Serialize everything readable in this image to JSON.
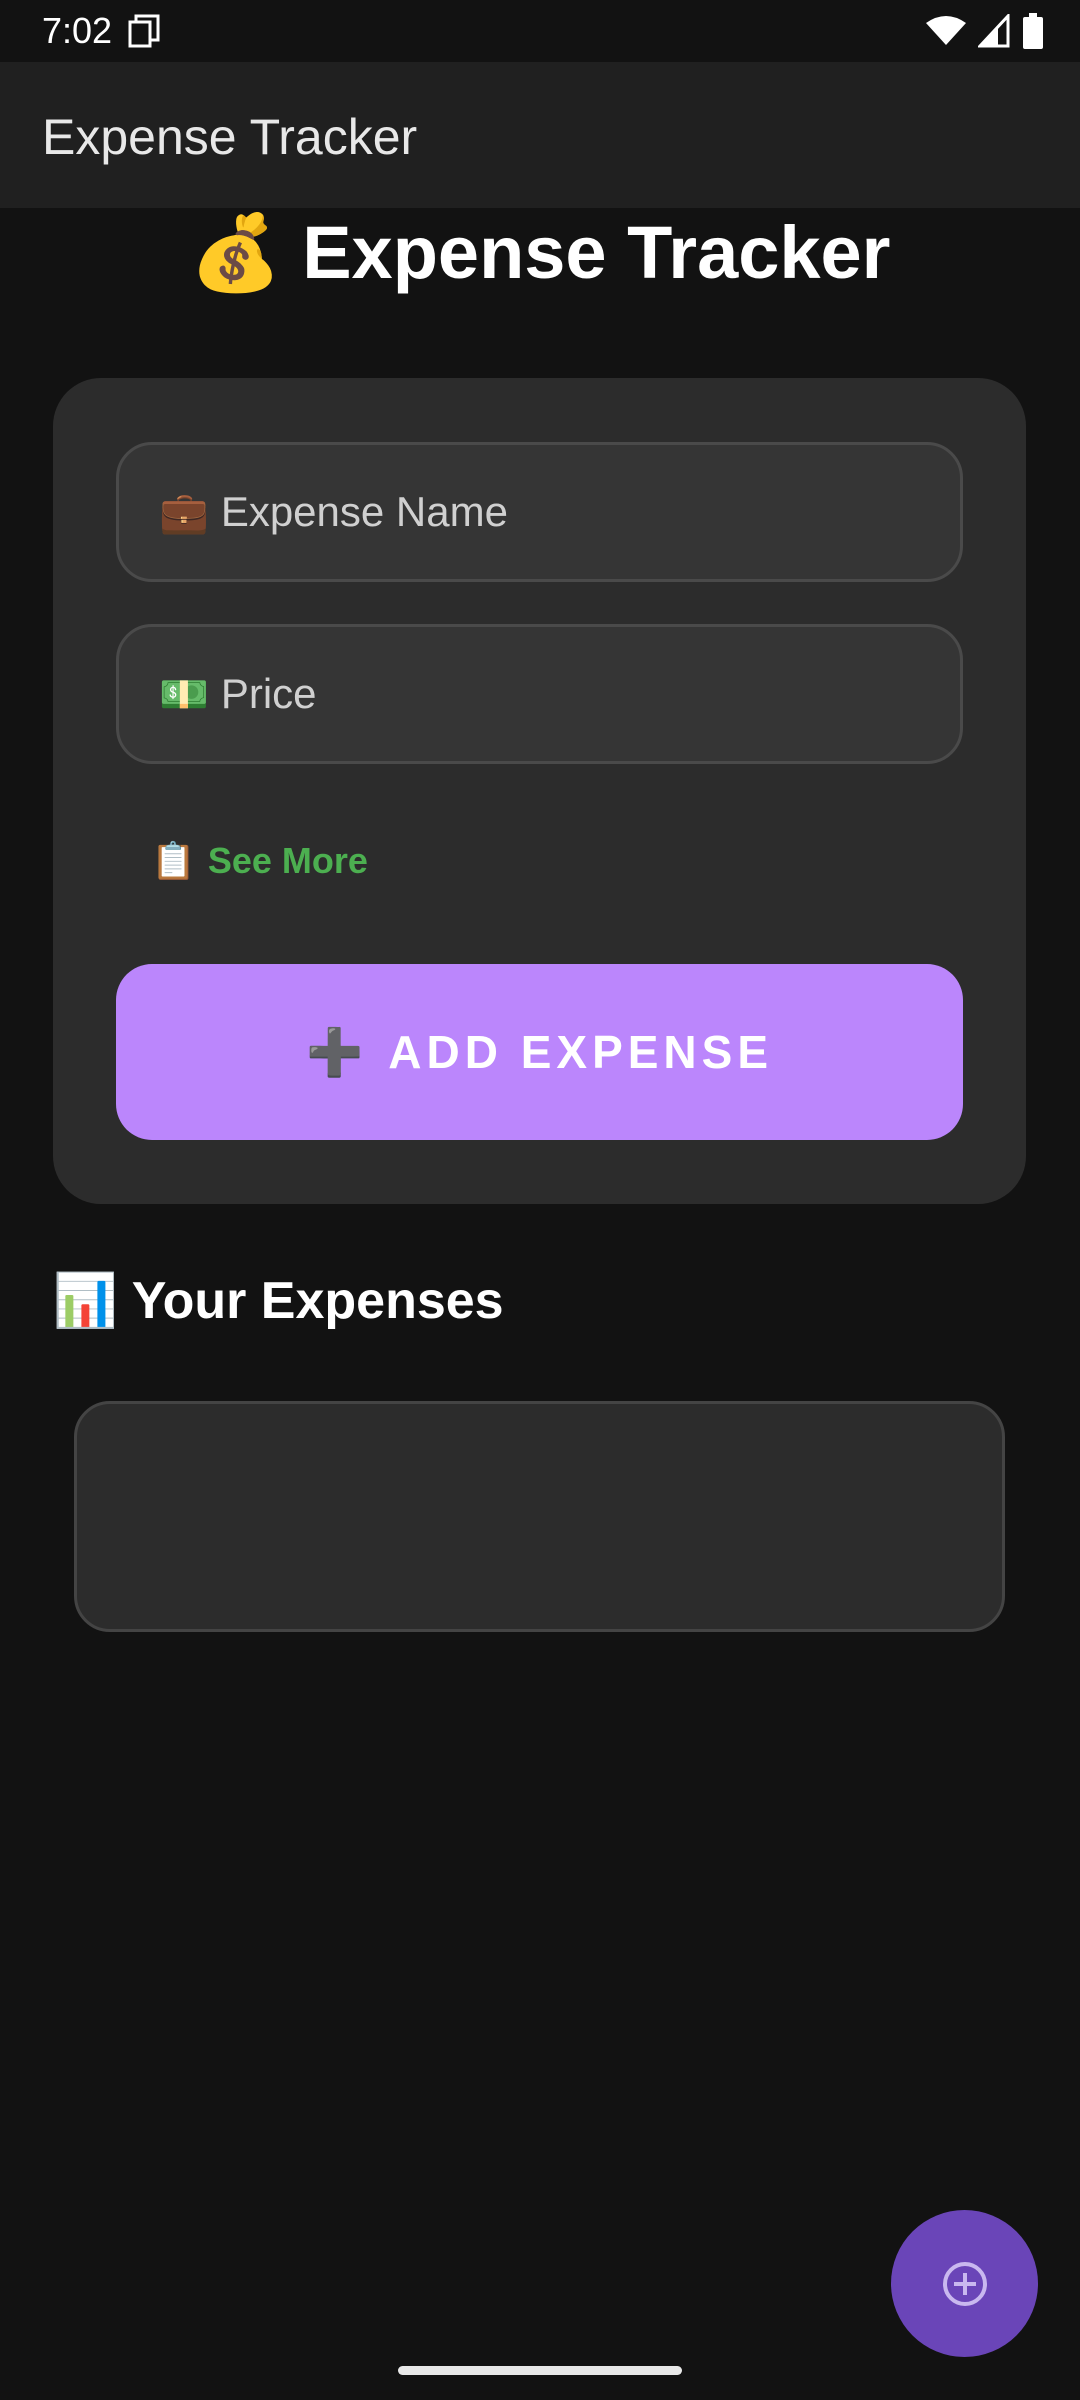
{
  "status_bar": {
    "time": "7:02"
  },
  "app_bar": {
    "title": "Expense Tracker"
  },
  "header": {
    "emoji": "💰",
    "title": "Expense Tracker"
  },
  "form": {
    "name_field": {
      "emoji": "💼",
      "placeholder": "Expense Name",
      "value": ""
    },
    "price_field": {
      "emoji": "💵",
      "placeholder": "Price",
      "value": ""
    },
    "see_more": {
      "emoji": "📋",
      "label": "See More"
    },
    "add_button": {
      "emoji": "➕",
      "label": "ADD EXPENSE"
    }
  },
  "expenses": {
    "emoji": "📊",
    "title": "Your Expenses",
    "items": []
  },
  "fab": {
    "icon": "add-circle-icon"
  },
  "colors": {
    "background": "#121212",
    "app_bar": "#202020",
    "card": "#2c2c2c",
    "accent": "#bb86fc",
    "see_more": "#4caf50",
    "fab": "#6a45b8"
  }
}
